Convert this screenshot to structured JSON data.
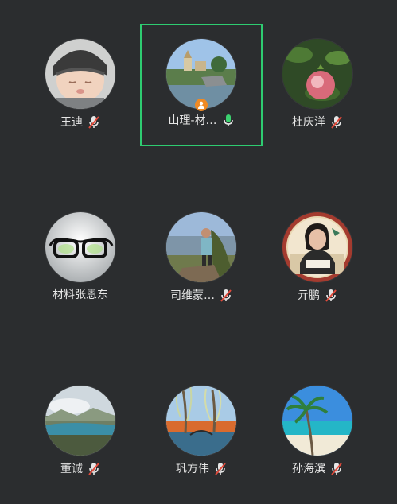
{
  "participants": [
    {
      "name": "王迪",
      "mic": "muted"
    },
    {
      "name": "山理-材…",
      "mic": "on",
      "active": true,
      "host": true
    },
    {
      "name": "杜庆洋",
      "mic": "muted"
    },
    {
      "name": "材料张恩东",
      "mic": "none"
    },
    {
      "name": "司维蒙…",
      "mic": "muted"
    },
    {
      "name": "亓鹏",
      "mic": "muted"
    },
    {
      "name": "董诚",
      "mic": "muted"
    },
    {
      "name": "巩方伟",
      "mic": "muted"
    },
    {
      "name": "孙海滨",
      "mic": "muted"
    }
  ],
  "icons": {
    "mic_on": "microphone-icon",
    "mic_muted": "microphone-muted-icon",
    "host": "host-person-icon"
  },
  "colors": {
    "background": "#2b2d2f",
    "active_border": "#2ecc71",
    "mic_on": "#3bd16f",
    "mic_muted_slash": "#e24a3b",
    "host_badge": "#f08a24"
  }
}
